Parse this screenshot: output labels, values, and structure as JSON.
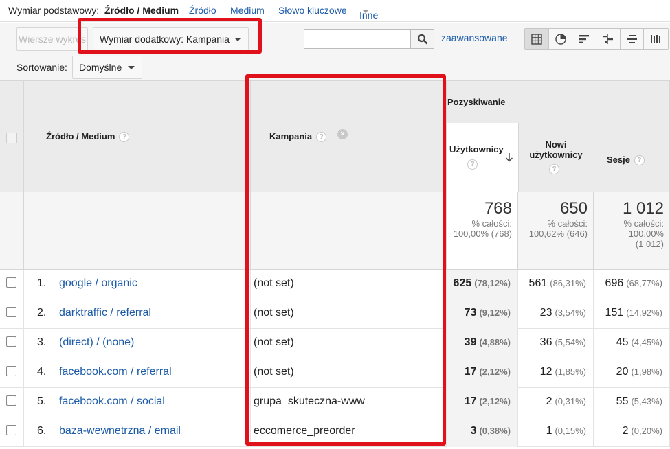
{
  "dimension_bar": {
    "label": "Wymiar podstawowy:",
    "active": "Źródło / Medium",
    "links": [
      "Źródło",
      "Medium",
      "Słowo kluczowe",
      "Inne"
    ]
  },
  "toolbar": {
    "plot_rows_label": "Wiersze wykresu",
    "secondary_dimension_label": "Wymiar dodatkowy: Kampania",
    "search_value": "",
    "advanced_label": "zaawansowane",
    "sort_label": "Sortowanie:",
    "sort_value": "Domyślne",
    "view_icons": [
      "table-view-icon",
      "pie-view-icon",
      "performance-view-icon",
      "comparison-view-icon",
      "term-cloud-view-icon",
      "pivot-view-icon"
    ]
  },
  "table": {
    "headers": {
      "source_medium": "Źródło / Medium",
      "campaign": "Kampania",
      "group": "Pozyskiwanie",
      "users": "Użytkownicy",
      "new_users_line1": "Nowi",
      "new_users_line2": "użytkownicy",
      "sessions": "Sesje",
      "help": "?"
    },
    "totals": {
      "users": {
        "value": "768",
        "line1": "% całości:",
        "line2": "100,00% (768)"
      },
      "new_users": {
        "value": "650",
        "line1": "% całości:",
        "line2": "100,62% (646)"
      },
      "sessions": {
        "value": "1 012",
        "line1": "% całości:",
        "line2": "100,00%",
        "line3": "(1 012)"
      }
    },
    "rows": [
      {
        "num": "1.",
        "source": "google / organic",
        "campaign": "(not set)",
        "users": "625",
        "users_pct": "(78,12%)",
        "new_users": "561",
        "new_users_pct": "(86,31%)",
        "sessions": "696",
        "sessions_pct": "(68,77%)"
      },
      {
        "num": "2.",
        "source": "darktraffic / referral",
        "campaign": "(not set)",
        "users": "73",
        "users_pct": "(9,12%)",
        "new_users": "23",
        "new_users_pct": "(3,54%)",
        "sessions": "151",
        "sessions_pct": "(14,92%)"
      },
      {
        "num": "3.",
        "source": "(direct) / (none)",
        "campaign": "(not set)",
        "users": "39",
        "users_pct": "(4,88%)",
        "new_users": "36",
        "new_users_pct": "(5,54%)",
        "sessions": "45",
        "sessions_pct": "(4,45%)"
      },
      {
        "num": "4.",
        "source": "facebook.com / referral",
        "campaign": "(not set)",
        "users": "17",
        "users_pct": "(2,12%)",
        "new_users": "12",
        "new_users_pct": "(1,85%)",
        "sessions": "20",
        "sessions_pct": "(1,98%)"
      },
      {
        "num": "5.",
        "source": "facebook.com / social",
        "campaign": "grupa_skuteczna-www",
        "users": "17",
        "users_pct": "(2,12%)",
        "new_users": "2",
        "new_users_pct": "(0,31%)",
        "sessions": "55",
        "sessions_pct": "(5,43%)"
      },
      {
        "num": "6.",
        "source": "baza-wewnetrzna / email",
        "campaign": "eccomerce_preorder",
        "users": "3",
        "users_pct": "(0,38%)",
        "new_users": "1",
        "new_users_pct": "(0,15%)",
        "sessions": "2",
        "sessions_pct": "(0,20%)"
      }
    ]
  },
  "colors": {
    "highlight": "#e0111b",
    "link": "#1a5aa8"
  }
}
